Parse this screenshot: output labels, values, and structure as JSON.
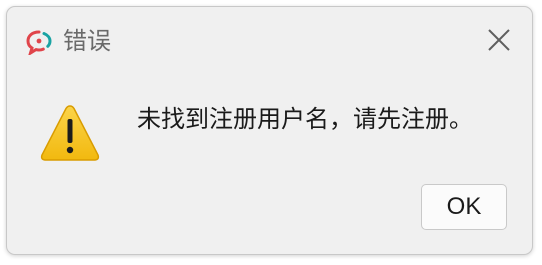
{
  "window": {
    "title": "错误",
    "app_icon": "chat-bubble-icon",
    "close_icon": "close-icon"
  },
  "message": {
    "icon": "warning-icon",
    "text": "未找到注册用户名，请先注册。"
  },
  "buttons": {
    "ok_label": "OK"
  },
  "colors": {
    "warning_fill": "#f6c21a",
    "app_icon_red": "#e0444a",
    "app_icon_teal": "#1aa3a3"
  }
}
